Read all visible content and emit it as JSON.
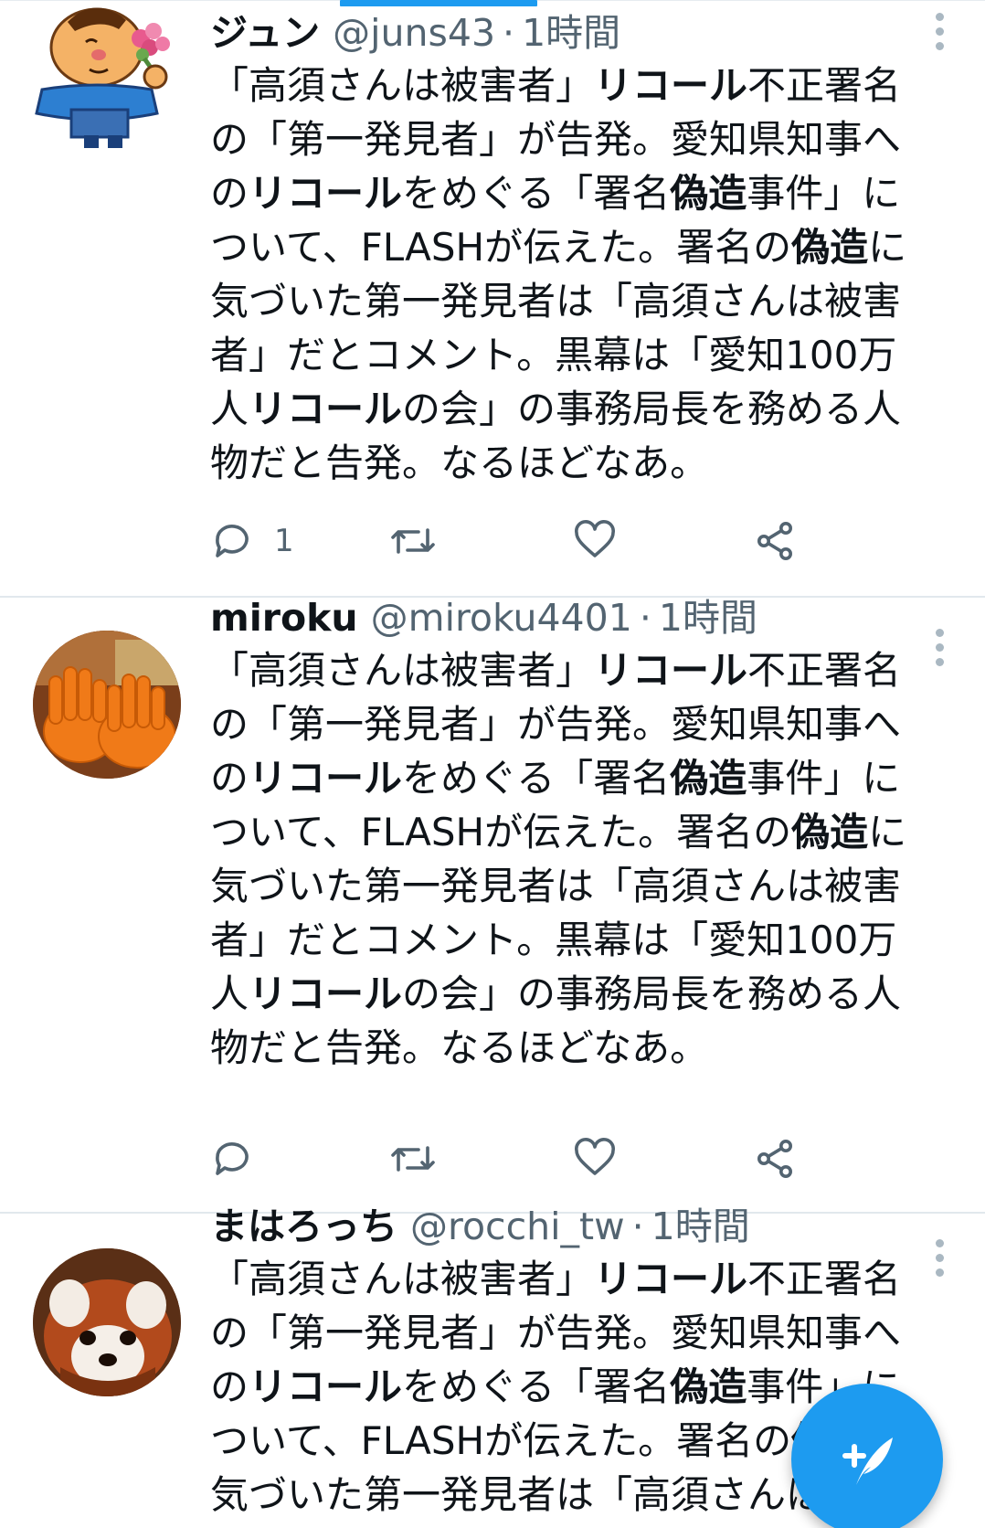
{
  "colors": {
    "accent": "#1d9bf0",
    "text": "#0f1419",
    "secondary_text": "#536471",
    "divider": "#e1e8ed"
  },
  "tweets": [
    {
      "display_name": "ジュン",
      "handle": "@juns43",
      "separator": "·",
      "time": "1時間",
      "avatar_icon": "cartoon-man-with-flowers-avatar",
      "text_segments": [
        {
          "t": "「高須さんは被害者」",
          "b": false
        },
        {
          "t": "リコール",
          "b": true
        },
        {
          "t": "不正署名の「第一発見者」が告発。愛知県知事への",
          "b": false
        },
        {
          "t": "リコール",
          "b": true
        },
        {
          "t": "をめぐる「署名",
          "b": false
        },
        {
          "t": "偽造",
          "b": true
        },
        {
          "t": "事件」について、FLASHが伝えた。署名の",
          "b": false
        },
        {
          "t": "偽造",
          "b": true
        },
        {
          "t": "に気づいた第一発見者は「高須さんは被害者」だとコメント。黒幕は「愛知100万人",
          "b": false
        },
        {
          "t": "リコール",
          "b": true
        },
        {
          "t": "の会」の事務局長を務める人物だと告発。なるほどなあ。",
          "b": false
        }
      ],
      "reply_count": "1",
      "retweet_count": "",
      "like_count": ""
    },
    {
      "display_name": "miroku",
      "handle": "@miroku4401",
      "separator": "·",
      "time": "1時間",
      "avatar_icon": "orange-hand-chairs-avatar",
      "text_segments": [
        {
          "t": "「高須さんは被害者」",
          "b": false
        },
        {
          "t": "リコール",
          "b": true
        },
        {
          "t": "不正署名の「第一発見者」が告発。愛知県知事への",
          "b": false
        },
        {
          "t": "リコール",
          "b": true
        },
        {
          "t": "をめぐる「署名",
          "b": false
        },
        {
          "t": "偽造",
          "b": true
        },
        {
          "t": "事件」について、FLASHが伝えた。署名の",
          "b": false
        },
        {
          "t": "偽造",
          "b": true
        },
        {
          "t": "に気づいた第一発見者は「高須さんは被害者」だとコメント。黒幕は「愛知100万人",
          "b": false
        },
        {
          "t": "リコール",
          "b": true
        },
        {
          "t": "の会」の事務局長を務める人物だと告発。なるほどなあ。",
          "b": false
        }
      ],
      "reply_count": "",
      "retweet_count": "",
      "like_count": ""
    },
    {
      "display_name": "まはろっち",
      "handle": "@rocchi_tw",
      "separator": "·",
      "time": "1時間",
      "avatar_icon": "red-panda-avatar",
      "text_segments": [
        {
          "t": "「高須さんは被害者」",
          "b": false
        },
        {
          "t": "リコール",
          "b": true
        },
        {
          "t": "不正署名の「第一発見者」が告発。愛知県知事への",
          "b": false
        },
        {
          "t": "リコール",
          "b": true
        },
        {
          "t": "をめぐる「署名",
          "b": false
        },
        {
          "t": "偽造",
          "b": true
        },
        {
          "t": "事件」について、FLASHが伝えた。署名の",
          "b": false
        },
        {
          "t": "偽造",
          "b": true
        },
        {
          "t": "に気づいた第一発見者は「高須さんは被害者」だとコメント。",
          "b": false
        }
      ],
      "reply_count": "",
      "retweet_count": "",
      "like_count": ""
    }
  ],
  "icons": {
    "reply": "reply-icon",
    "retweet": "retweet-icon",
    "like": "heart-icon",
    "share": "share-icon",
    "more": "more-vertical-icon",
    "compose": "compose-tweet-icon"
  }
}
